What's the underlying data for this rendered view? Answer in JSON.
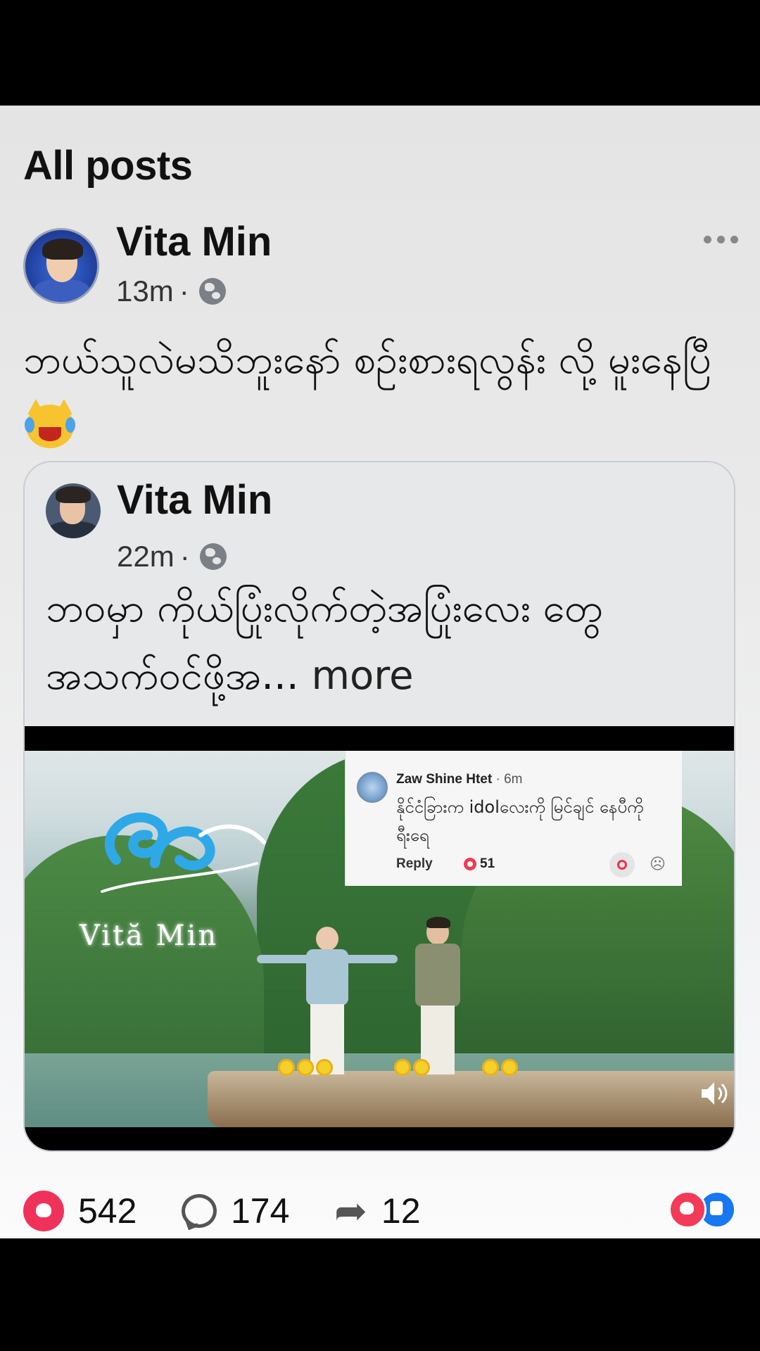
{
  "feed": {
    "section_title": "All posts"
  },
  "post": {
    "author": "Vita Min",
    "time": "13m",
    "separator": "·",
    "text": "ဘယ်သူလဲမသိဘူးနော် စဉ်းစားရလွန်း လို့ မူးနေပြီ",
    "emoji": "crying-laughing-cat-icon"
  },
  "shared_post": {
    "author": "Vita Min",
    "time": "22m",
    "separator": "·",
    "text": "ဘဝမှာ ကိုယ်ပြုံးလိုက်တဲ့အပြုံးလေး တွေ အသက်ဝင်ဖို့အ...",
    "more_label": "more"
  },
  "video": {
    "logo_text": "Vită Min",
    "comment_overlay": {
      "author": "Zaw Shine Htet",
      "time": "6m",
      "separator": "·",
      "text": "နိုင်ငံခြားက idolလေးကို မြင်ချင် နေပီကိုရီးရေ",
      "reply_label": "Reply",
      "likes": "51"
    }
  },
  "actions": {
    "likes": "542",
    "comments": "174",
    "shares": "12"
  },
  "colors": {
    "heart": "#f0325a",
    "like_blue": "#1877f2"
  }
}
